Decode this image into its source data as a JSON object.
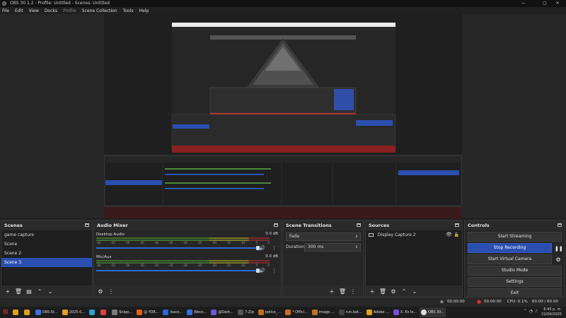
{
  "window": {
    "title": "OBS 30.1.2 - Profile: Untitled - Scenes: Untitled",
    "minimize": "—",
    "maximize": "▢",
    "close": "✕"
  },
  "menu": [
    "File",
    "Edit",
    "View",
    "Docks",
    "Profile",
    "Scene Collection",
    "Tools",
    "Help"
  ],
  "scenes": {
    "title": "Scenes",
    "items": [
      "game capture",
      "Scene",
      "Scene 2",
      "Scene 3"
    ],
    "selected": "Scene 3"
  },
  "mixer": {
    "title": "Audio Mixer",
    "ticks": [
      "-60",
      "-55",
      "-50",
      "-45",
      "-40",
      "-35",
      "-30",
      "-25",
      "-20",
      "-15",
      "-10",
      "-5",
      "0"
    ],
    "channels": [
      {
        "name": "Desktop Audio",
        "db": "0.0 dB",
        "volume": 1.0
      },
      {
        "name": "Mic/Aux",
        "db": "0.0 dB",
        "volume": 1.0
      }
    ]
  },
  "transitions": {
    "title": "Scene Transitions",
    "transition": "Fade",
    "duration_label": "Duration",
    "duration_value": "300 ms"
  },
  "sources": {
    "title": "Sources",
    "items": [
      "Display Capture 2"
    ]
  },
  "controls": {
    "title": "Controls",
    "start_streaming": "Start Streaming",
    "stop_recording": "Stop Recording",
    "start_virtual_camera": "Start Virtual Camera",
    "studio_mode": "Studio Mode",
    "settings": "Settings",
    "exit": "Exit"
  },
  "status": {
    "rec_time": "00:00:00",
    "stream_time": "00:00:00",
    "cpu": "CPU: 0.1%",
    "fps": "60.00 / 60.00 FPS"
  },
  "taskbar": {
    "items": [
      "OBS-St...",
      "2025-0...",
      "Snipp...",
      "@ YOR...",
      "Isaco...",
      "Weco...",
      "@Dark...",
      "7-Zip",
      "police_...",
      "* Offici...",
      "image ...",
      "run.bat...",
      "Adobe ...",
      "X. Es lo...",
      "OBS 30..."
    ],
    "colors": [
      "#3a6fd8",
      "#e0a020",
      "#7a7a7a",
      "#e04040",
      "#2a6ad8",
      "#3070e0",
      "#6a5ad0",
      "#555",
      "#c07020",
      "#d06a20",
      "#c07020",
      "#444",
      "#e0a020",
      "#7a4ae0",
      "#ddd"
    ],
    "time": "6:45 p. m.",
    "date": "21/04/2025"
  }
}
